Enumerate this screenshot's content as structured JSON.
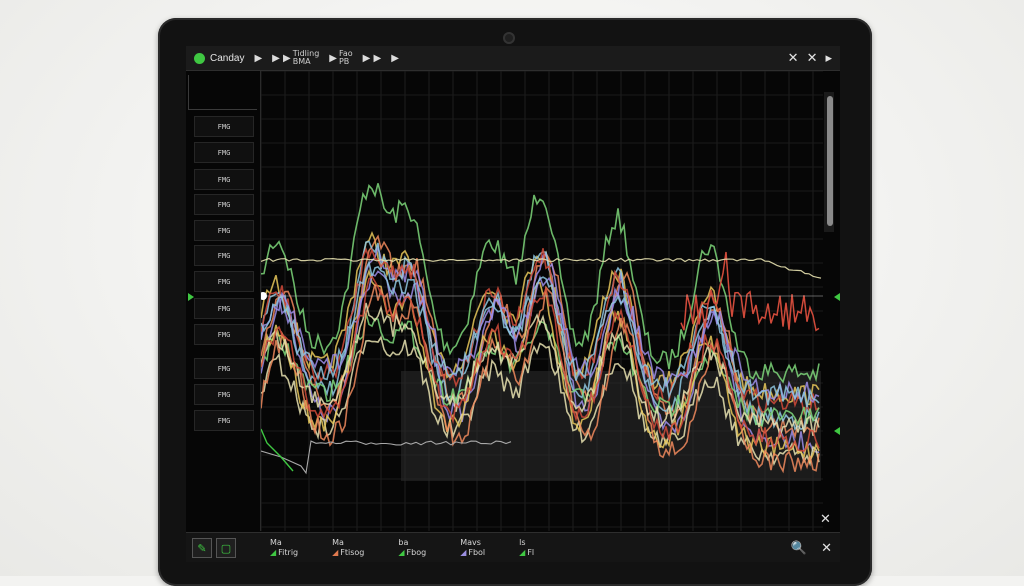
{
  "app": {
    "title": "Canday",
    "toolbar": [
      {
        "glyph": "▶",
        "label": "",
        "sub": ""
      },
      {
        "glyph": "▶ ▶",
        "label": "Tidling",
        "sub": "BMA"
      },
      {
        "glyph": "▶",
        "label": "Fao",
        "sub": "PB"
      },
      {
        "glyph": "▶ ▶",
        "label": "",
        "sub": ""
      },
      {
        "glyph": "▶",
        "label": "",
        "sub": ""
      }
    ],
    "window_controls": [
      "✕",
      "✕",
      "▸"
    ]
  },
  "lanes": [
    "FMG",
    "FMG",
    "FMG",
    "FMG",
    "FMG",
    "FMG",
    "FMG",
    "FMG",
    "FMG",
    "FMG",
    "FMG",
    "FMG"
  ],
  "bottom": {
    "legend": [
      {
        "top": "Ma",
        "bot": "Fitrig",
        "color": "#3fc742"
      },
      {
        "top": "Ma",
        "bot": "Ftisog",
        "color": "#e07a4f"
      },
      {
        "top": "ba",
        "bot": "Fbog",
        "color": "#3fc742"
      },
      {
        "top": "Mavs",
        "bot": "Fbol",
        "color": "#9a8ee0"
      },
      {
        "top": "ls",
        "bot": "Fl",
        "color": "#3fc742"
      }
    ],
    "right_controls": [
      "🔍",
      "✕"
    ]
  },
  "colors": {
    "accent": "#3fc742",
    "series": [
      "#7ed77a",
      "#e8c85a",
      "#f08a5d",
      "#9c8de8",
      "#8ec7e0",
      "#e8e2b0",
      "#d04a3a",
      "#ffffff"
    ]
  }
}
